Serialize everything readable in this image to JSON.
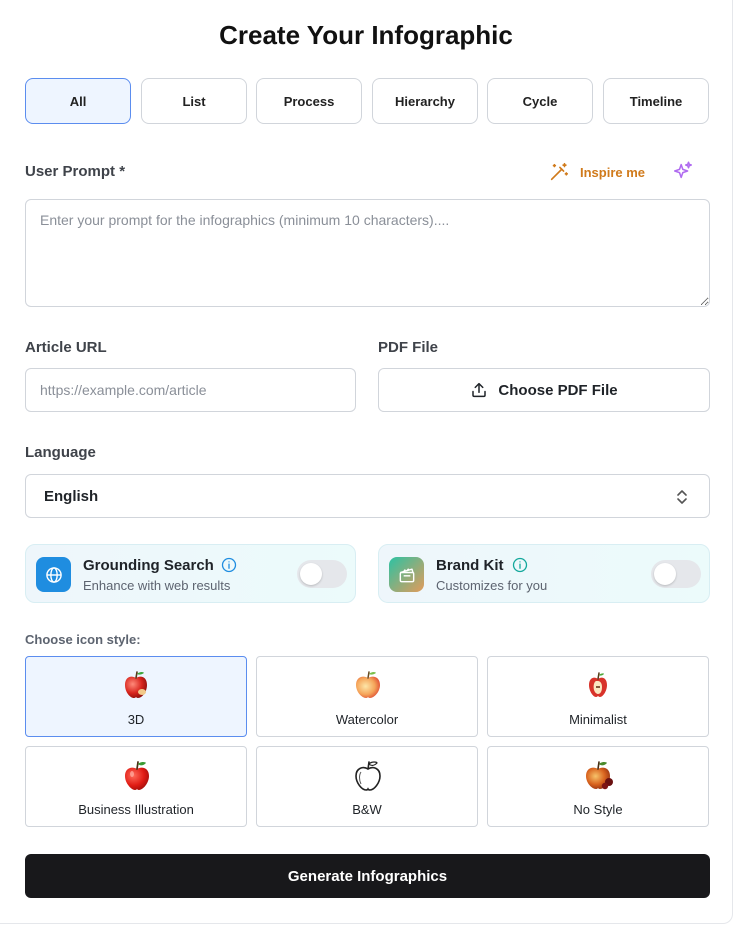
{
  "title": "Create Your Infographic",
  "tabs": [
    {
      "label": "All",
      "active": true
    },
    {
      "label": "List",
      "active": false
    },
    {
      "label": "Process",
      "active": false
    },
    {
      "label": "Hierarchy",
      "active": false
    },
    {
      "label": "Cycle",
      "active": false
    },
    {
      "label": "Timeline",
      "active": false
    }
  ],
  "prompt": {
    "label": "User Prompt *",
    "placeholder": "Enter your prompt for the infographics (minimum 10 characters)....",
    "value": "",
    "inspire_label": "Inspire me"
  },
  "article": {
    "label": "Article URL",
    "placeholder": "https://example.com/article",
    "value": ""
  },
  "pdf": {
    "label": "PDF File",
    "button_label": "Choose PDF File"
  },
  "language": {
    "label": "Language",
    "selected": "English"
  },
  "features": {
    "grounding": {
      "name": "Grounding Search",
      "description": "Enhance with web results",
      "enabled": false,
      "icon": "globe-icon",
      "accent": "#1f8de0"
    },
    "brand_kit": {
      "name": "Brand Kit",
      "description": "Customizes for you",
      "enabled": false,
      "icon": "clapperboard-icon",
      "accent": "#2cc2a3"
    }
  },
  "icon_style": {
    "label": "Choose icon style:",
    "options": [
      {
        "label": "3D",
        "selected": true,
        "icon": "apple-3d-icon"
      },
      {
        "label": "Watercolor",
        "selected": false,
        "icon": "apple-watercolor-icon"
      },
      {
        "label": "Minimalist",
        "selected": false,
        "icon": "apple-minimalist-icon"
      },
      {
        "label": "Business Illustration",
        "selected": false,
        "icon": "apple-business-icon"
      },
      {
        "label": "B&W",
        "selected": false,
        "icon": "apple-bw-icon"
      },
      {
        "label": "No Style",
        "selected": false,
        "icon": "apple-nostyle-icon"
      }
    ]
  },
  "generate_label": "Generate Infographics",
  "colors": {
    "active_tab_bg": "#eef5ff",
    "active_border": "#5b8def",
    "inspire": "#d07a1b",
    "sparkle": "#b06cf0",
    "generate_bg": "#18181b"
  }
}
